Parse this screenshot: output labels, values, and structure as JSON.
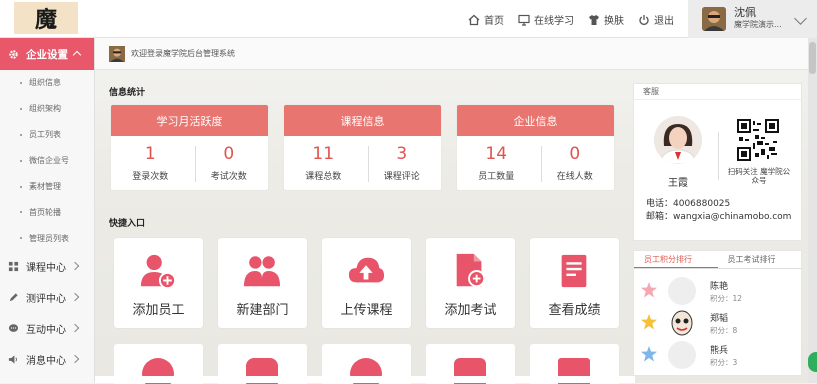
{
  "header": {
    "logo_text": "魔",
    "nav": [
      {
        "icon": "home-icon",
        "label": "首页"
      },
      {
        "icon": "monitor-icon",
        "label": "在线学习"
      },
      {
        "icon": "shirt-icon",
        "label": "换肤"
      },
      {
        "icon": "power-icon",
        "label": "退出"
      }
    ],
    "user": {
      "name": "沈佩",
      "org": "魔学院演示..."
    }
  },
  "sidebar": {
    "active_menu": "企业设置",
    "sub_items": [
      "组织信息",
      "组织架构",
      "员工列表",
      "微信企业号",
      "素材管理",
      "首页轮播",
      "管理员列表"
    ],
    "menus": [
      {
        "icon": "grid-icon",
        "label": "课程中心"
      },
      {
        "icon": "pencil-icon",
        "label": "测评中心"
      },
      {
        "icon": "chat-icon",
        "label": "互动中心"
      },
      {
        "icon": "speaker-icon",
        "label": "消息中心"
      }
    ]
  },
  "welcome": "欢迎登录魔学院后台管理系统",
  "stats_title": "信息统计",
  "stats": [
    {
      "title": "学习月活跃度",
      "items": [
        {
          "value": "1",
          "label": "登录次数"
        },
        {
          "value": "0",
          "label": "考试次数"
        }
      ]
    },
    {
      "title": "课程信息",
      "items": [
        {
          "value": "11",
          "label": "课程总数"
        },
        {
          "value": "3",
          "label": "课程评论"
        }
      ]
    },
    {
      "title": "企业信息",
      "items": [
        {
          "value": "14",
          "label": "员工数量"
        },
        {
          "value": "0",
          "label": "在线人数"
        }
      ]
    }
  ],
  "quick_title": "快捷入口",
  "quick": [
    {
      "icon": "add-user-icon",
      "label": "添加员工"
    },
    {
      "icon": "group-icon",
      "label": "新建部门"
    },
    {
      "icon": "cloud-upload-icon",
      "label": "上传课程"
    },
    {
      "icon": "add-exam-icon",
      "label": "添加考试"
    },
    {
      "icon": "document-icon",
      "label": "查看成绩"
    }
  ],
  "service": {
    "title": "客服",
    "name": "王霞",
    "qr_caption": "扫码关注 魔学院公众号",
    "phone": "电话：4006880025",
    "email": "邮箱：wangxia@chinamobo.com"
  },
  "ranking": {
    "tabs": [
      "员工积分排行",
      "员工考试排行"
    ],
    "rows": [
      {
        "rank": "1",
        "name": "陈艳",
        "score": "积分：12"
      },
      {
        "rank": "2",
        "name": "郑韬",
        "score": "积分：8"
      },
      {
        "rank": "3",
        "name": "熊兵",
        "score": "积分：3"
      }
    ]
  },
  "colors": {
    "accent": "#e8586a",
    "stat_header": "#e8756f",
    "stat_number": "#e0544f"
  }
}
